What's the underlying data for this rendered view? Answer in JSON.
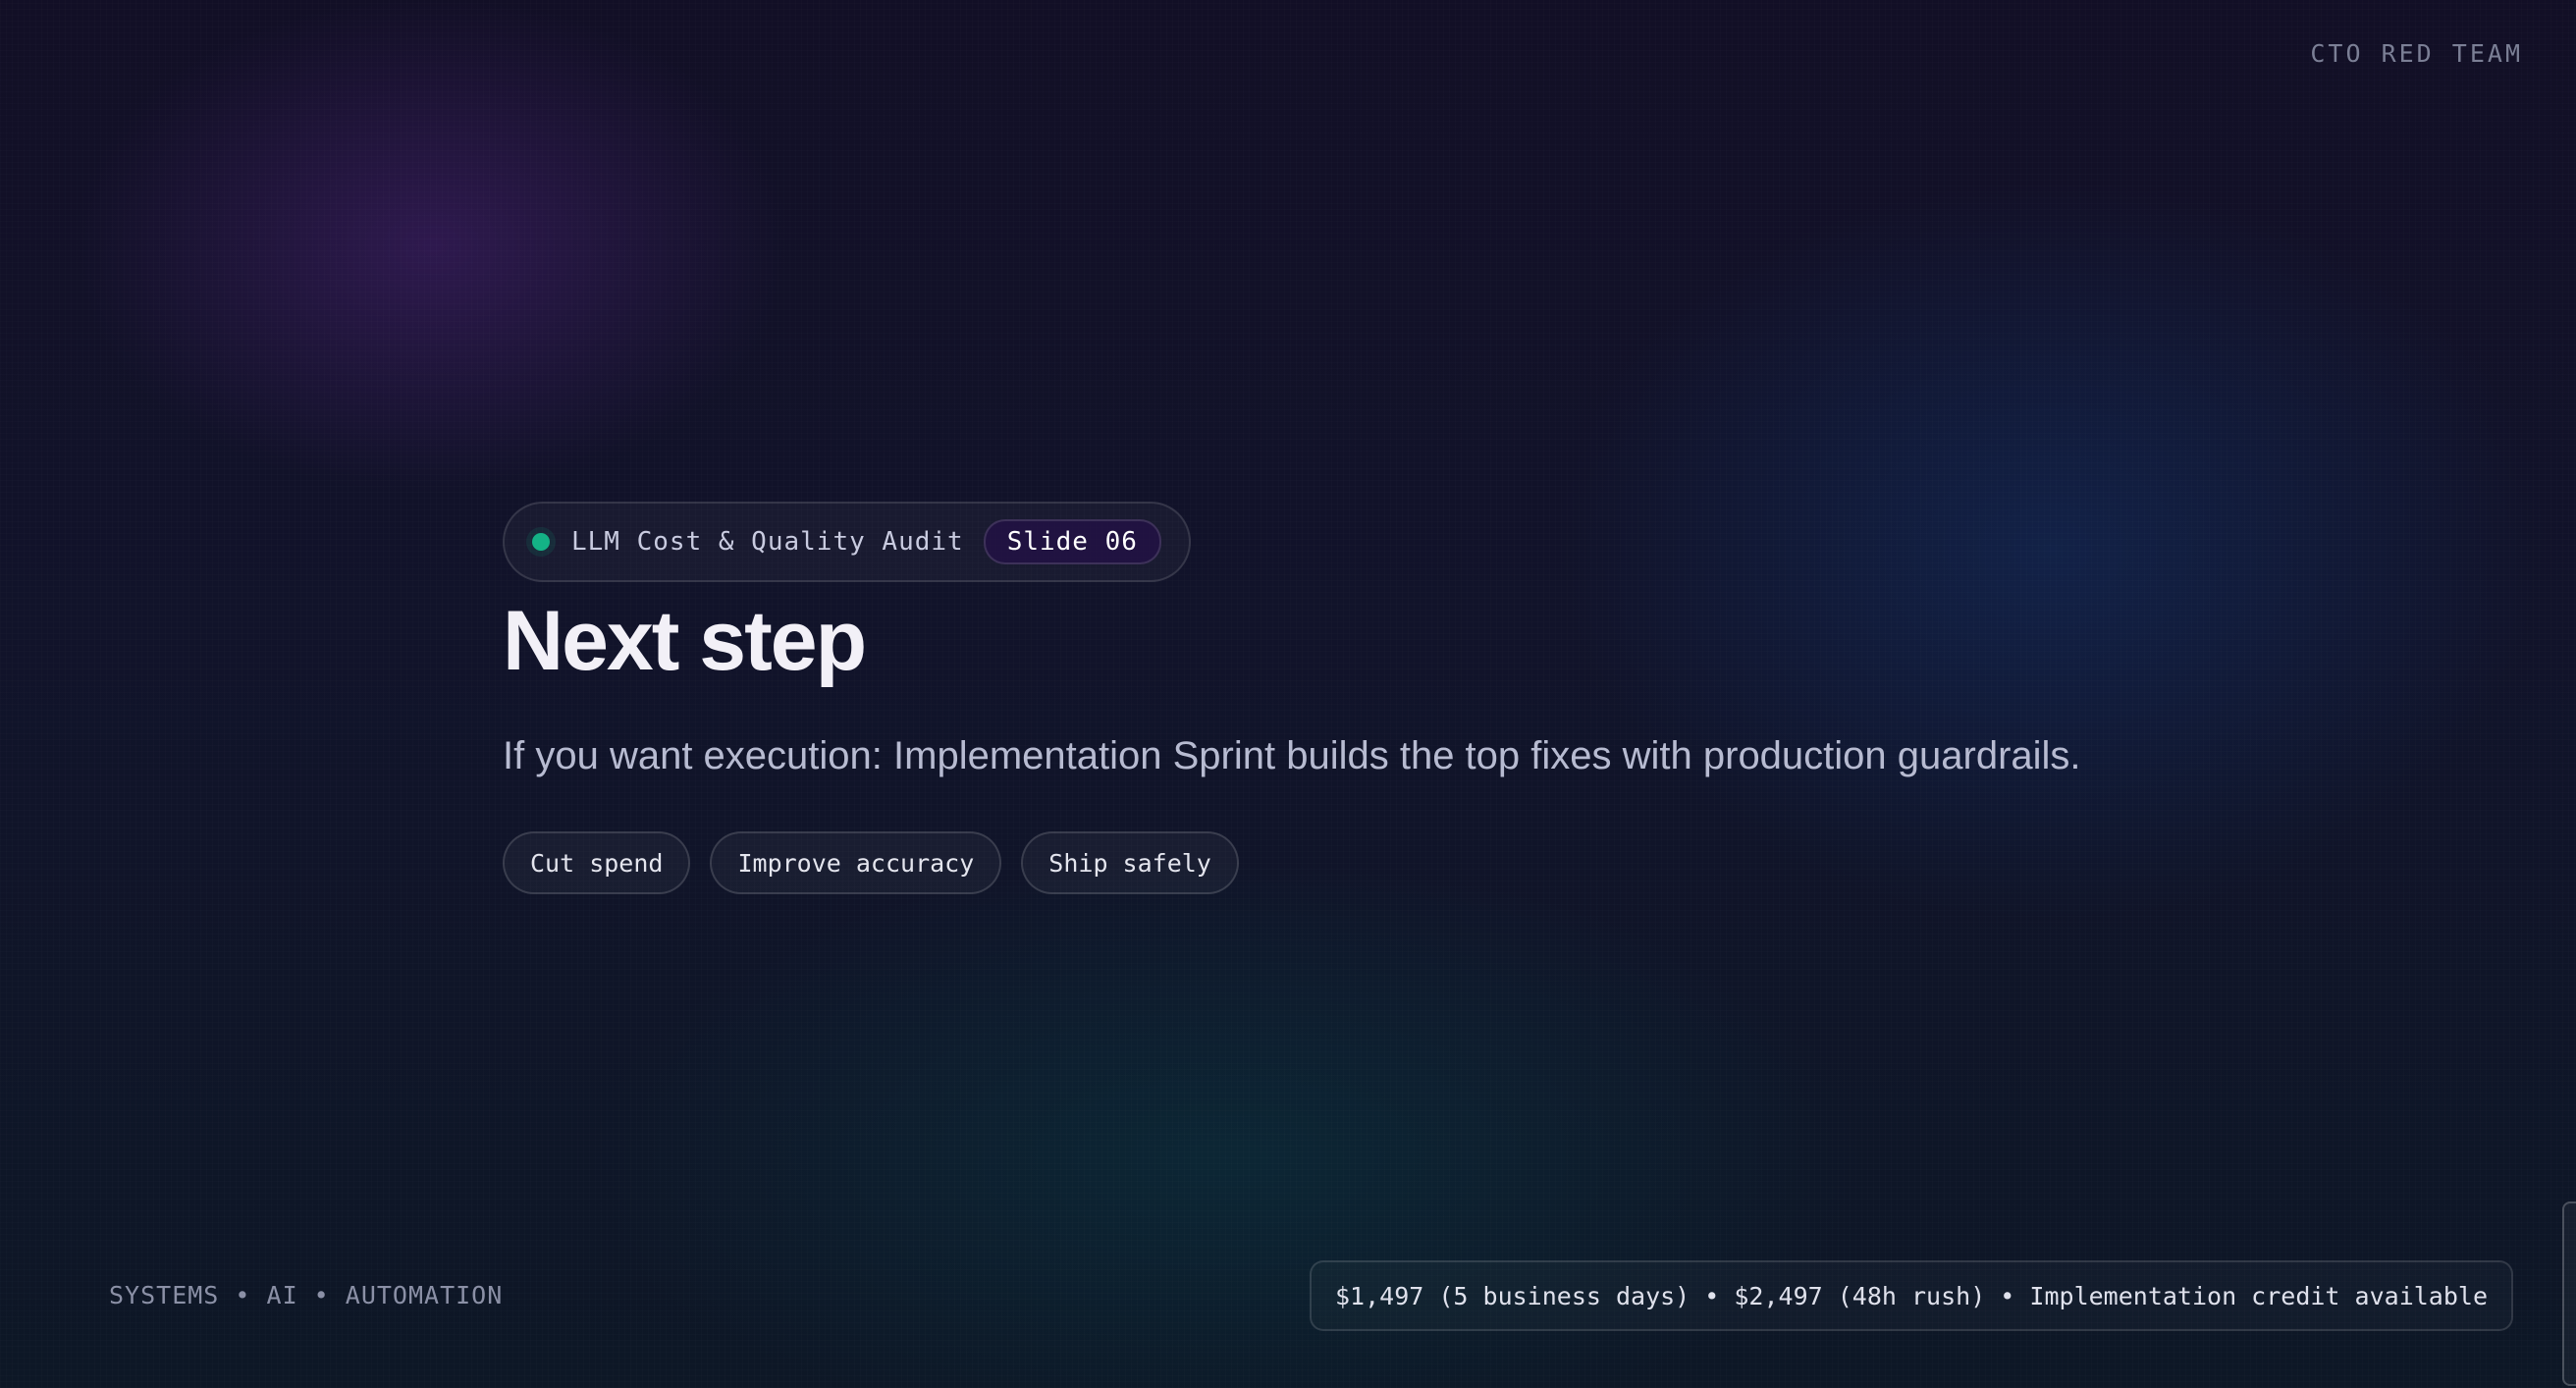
{
  "brand": {
    "label": "CTO RED TEAM"
  },
  "header_pill": {
    "label": "LLM Cost & Quality Audit",
    "badge": "Slide 06",
    "status_color": "#14b386"
  },
  "title": "Next step",
  "subtitle": "If you want execution: Implementation Sprint builds the top fixes with production guardrails.",
  "chips": [
    {
      "label": "Cut spend"
    },
    {
      "label": "Improve accuracy"
    },
    {
      "label": "Ship safely"
    }
  ],
  "footer": {
    "left": "SYSTEMS • AI • AUTOMATION",
    "pricing": "$1,497 (5 business days) • $2,497 (48h rush) • Implementation credit available"
  },
  "colors": {
    "background": "#0b0d1c",
    "accent_green": "#14b386",
    "text_primary": "#f2f0f7"
  }
}
